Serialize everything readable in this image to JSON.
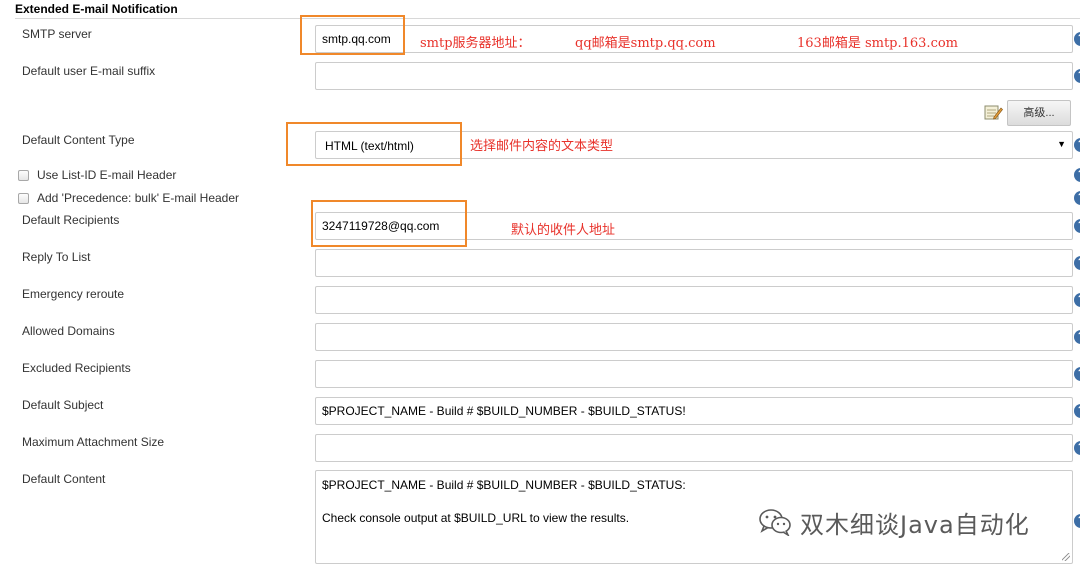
{
  "section": {
    "title": "Extended E-mail Notification"
  },
  "fields": {
    "smtp_server": {
      "label": "SMTP server",
      "value": "smtp.qq.com"
    },
    "default_suffix": {
      "label": "Default user E-mail suffix",
      "value": ""
    },
    "advanced_button": {
      "label": "高级..."
    },
    "content_type": {
      "label": "Default Content Type",
      "value": "HTML (text/html)"
    },
    "use_list_id": {
      "label": "Use List-ID E-mail Header",
      "checked": false
    },
    "precedence_bulk": {
      "label": "Add 'Precedence: bulk' E-mail Header",
      "checked": false
    },
    "default_recipients": {
      "label": "Default Recipients",
      "value": "3247119728@qq.com"
    },
    "reply_to": {
      "label": "Reply To List",
      "value": ""
    },
    "emergency_reroute": {
      "label": "Emergency reroute",
      "value": ""
    },
    "allowed_domains": {
      "label": "Allowed Domains",
      "value": ""
    },
    "excluded_recipients": {
      "label": "Excluded Recipients",
      "value": ""
    },
    "default_subject": {
      "label": "Default Subject",
      "value": "$PROJECT_NAME - Build # $BUILD_NUMBER - $BUILD_STATUS!"
    },
    "max_attachment": {
      "label": "Maximum Attachment Size",
      "value": ""
    },
    "default_content": {
      "label": "Default Content",
      "line1": "$PROJECT_NAME - Build # $BUILD_NUMBER - $BUILD_STATUS:",
      "line2": "Check console output at $BUILD_URL to view the results."
    }
  },
  "annotations": {
    "smtp_note": "smtp服务器地址：",
    "qq_note": "qq邮箱是smtp.qq.com",
    "netease_note": "163邮箱是 smtp.163.com",
    "content_type_note": "选择邮件内容的文本类型",
    "recipients_note": "默认的收件人地址"
  },
  "help": {
    "glyph": "?"
  },
  "select_arrow": "▼",
  "watermark": {
    "text": "双木细谈Java自动化",
    "icon": "wechat-icon"
  },
  "colors": {
    "annotation_box": "#f0882a",
    "annotation_text": "#e8312a",
    "help_icon": "#3d6ea6"
  }
}
